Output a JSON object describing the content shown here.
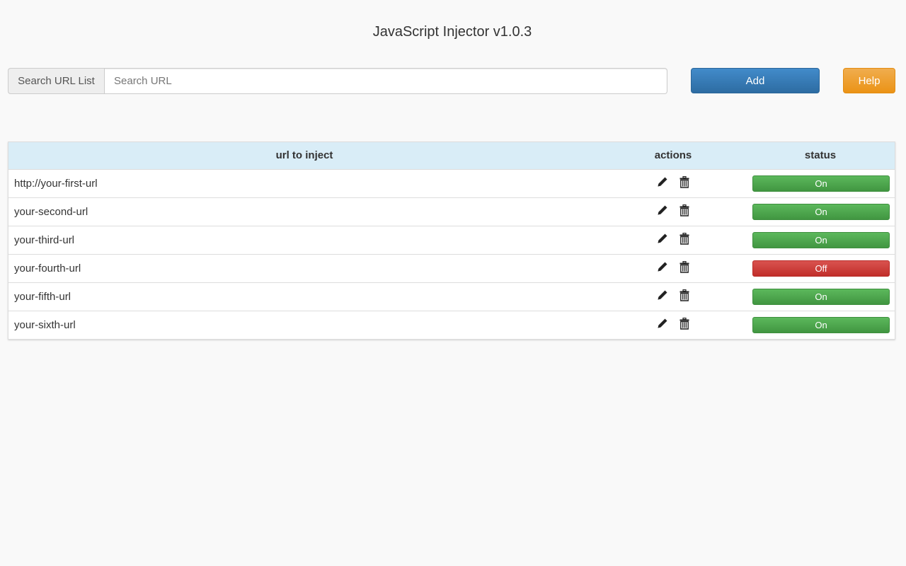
{
  "header": {
    "title": "JavaScript Injector v1.0.3"
  },
  "search": {
    "addon_label": "Search URL List",
    "placeholder": "Search URL",
    "value": ""
  },
  "toolbar": {
    "add_label": "Add",
    "help_label": "Help"
  },
  "colors": {
    "primary": "#337ab7",
    "warning": "#f0ad4e",
    "success": "#5cb85c",
    "danger": "#d9534f",
    "table_header_bg": "#d9edf7"
  },
  "table": {
    "columns": [
      "url to inject",
      "actions",
      "status"
    ],
    "rows": [
      {
        "url": "http://your-first-url",
        "status": "On",
        "enabled": true
      },
      {
        "url": "your-second-url",
        "status": "On",
        "enabled": true
      },
      {
        "url": "your-third-url",
        "status": "On",
        "enabled": true
      },
      {
        "url": "your-fourth-url",
        "status": "Off",
        "enabled": false
      },
      {
        "url": "your-fifth-url",
        "status": "On",
        "enabled": true
      },
      {
        "url": "your-sixth-url",
        "status": "On",
        "enabled": true
      }
    ],
    "action_icons": [
      "pencil-icon",
      "trash-icon"
    ]
  }
}
